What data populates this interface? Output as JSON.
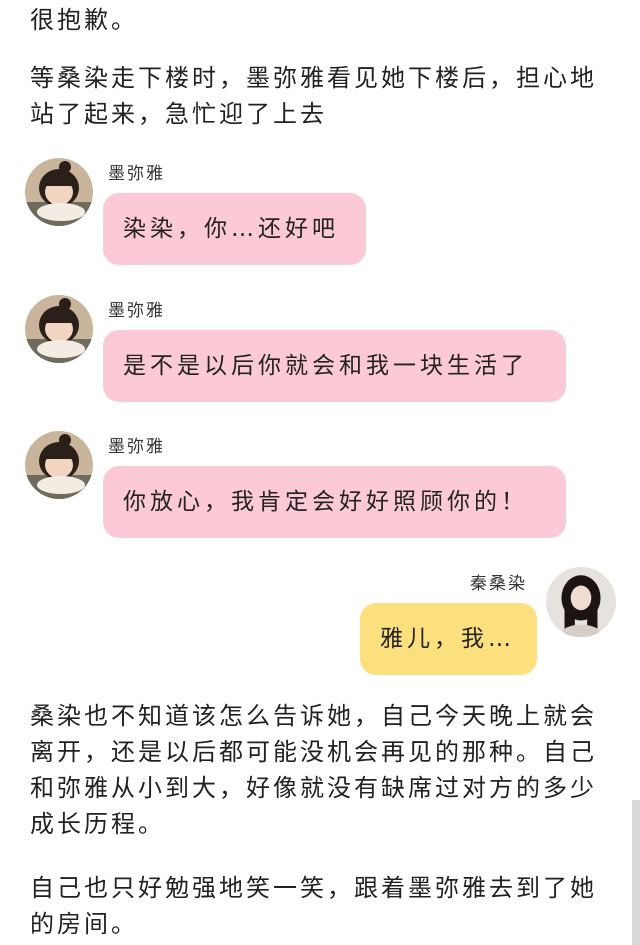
{
  "story": {
    "p0": "很抱歉。",
    "p1": "等桑染走下楼时，墨弥雅看见她下楼后，担心地站了起来，急忙迎了上去",
    "p2": "桑染也不知道该怎么告诉她，自己今天晚上就会离开，还是以后都可能没机会再见的那种。自己和弥雅从小到大，好像就没有缺席过对方的多少成长历程。",
    "p3": "自己也只好勉强地笑一笑，跟着墨弥雅去到了她的房间。"
  },
  "chat": [
    {
      "sender": "墨弥雅",
      "text": "染染，你…还好吧",
      "side": "left",
      "bubble_color": "#fbcad6"
    },
    {
      "sender": "墨弥雅",
      "text": "是不是以后你就会和我一块生活了",
      "side": "left",
      "bubble_color": "#fbcad6"
    },
    {
      "sender": "墨弥雅",
      "text": "你放心，我肯定会好好照顾你的！",
      "side": "left",
      "bubble_color": "#fbcad6"
    },
    {
      "sender": "秦桑染",
      "text": "雅儿，我…",
      "side": "right",
      "bubble_color": "#fde07e"
    }
  ]
}
